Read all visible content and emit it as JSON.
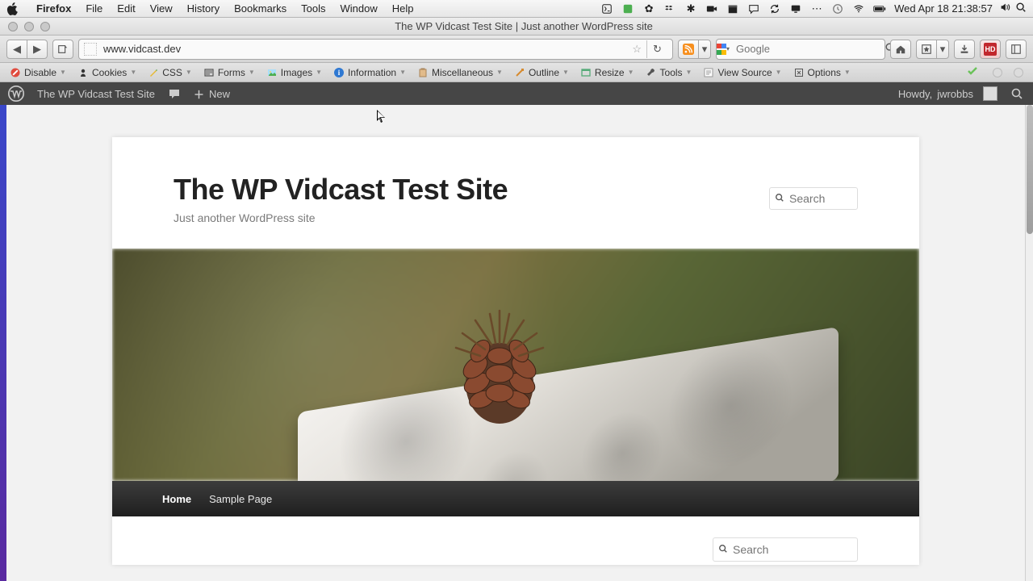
{
  "mac": {
    "app": "Firefox",
    "menus": [
      "File",
      "Edit",
      "View",
      "History",
      "Bookmarks",
      "Tools",
      "Window",
      "Help"
    ],
    "clock": "Wed Apr 18  21:38:57"
  },
  "window": {
    "title": "The WP Vidcast Test Site | Just another WordPress site"
  },
  "browser": {
    "url": "www.vidcast.dev",
    "search_engine_placeholder": "Google",
    "hd_badge": "HD"
  },
  "webdev": {
    "items": [
      "Disable",
      "Cookies",
      "CSS",
      "Forms",
      "Images",
      "Information",
      "Miscellaneous",
      "Outline",
      "Resize",
      "Tools",
      "View Source",
      "Options"
    ]
  },
  "wpbar": {
    "site_name": "The WP Vidcast Test Site",
    "new_label": "New",
    "howdy_prefix": "Howdy, ",
    "user": "jwrobbs"
  },
  "site": {
    "title": "The WP Vidcast Test Site",
    "tagline": "Just another WordPress site",
    "search_placeholder": "Search",
    "nav": {
      "home": "Home",
      "sample": "Sample Page"
    },
    "widget_search_placeholder": "Search"
  }
}
